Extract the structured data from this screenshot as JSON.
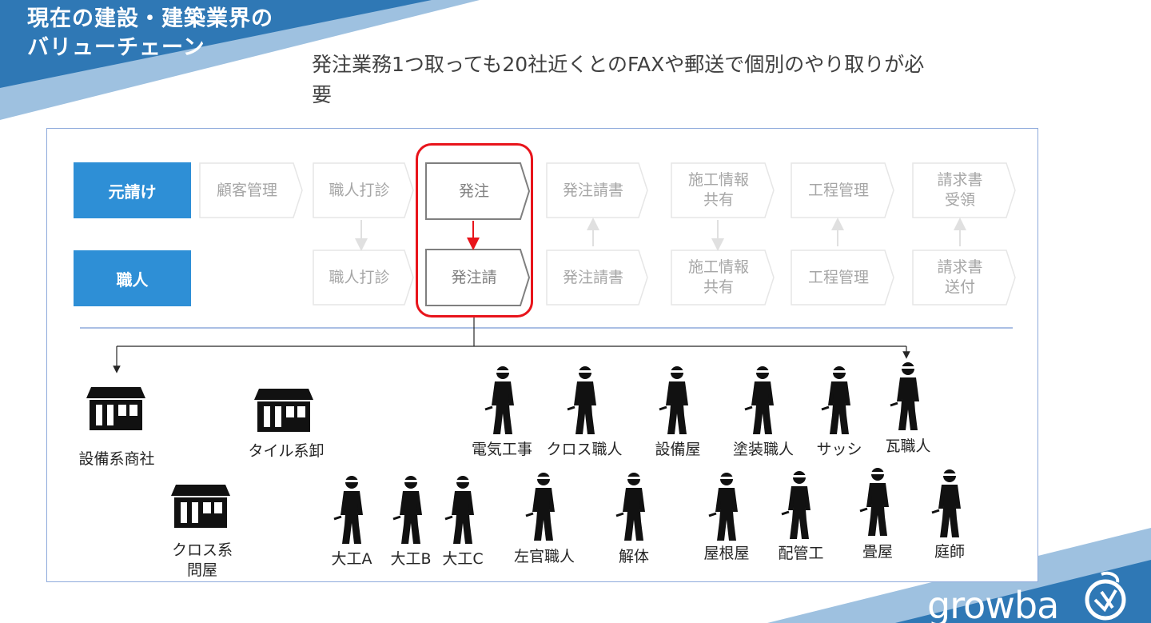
{
  "title": "現在の建設・建築業界の\nバリューチェーン",
  "subtitle": "発注業務1つ取っても20社近くとのFAXや郵送で個別のやり取りが必要",
  "roles": {
    "motouke": "元請け",
    "shokunin": "職人"
  },
  "process_top": [
    {
      "label": "顧客管理"
    },
    {
      "label": "職人打診"
    },
    {
      "label": "発注",
      "active": true
    },
    {
      "label": "発注請書"
    },
    {
      "label": "施工情報\n共有"
    },
    {
      "label": "工程管理"
    },
    {
      "label": "請求書\n受領"
    }
  ],
  "process_bottom": [
    {
      "label": "職人打診"
    },
    {
      "label": "発注請",
      "active": true
    },
    {
      "label": "発注請書"
    },
    {
      "label": "施工情報\n共有"
    },
    {
      "label": "工程管理"
    },
    {
      "label": "請求書\n送付"
    }
  ],
  "suppliers": [
    {
      "label": "設備系商社"
    },
    {
      "label": "タイル系卸"
    },
    {
      "label": "クロス系\n問屋"
    }
  ],
  "workers_row1": [
    "電気工事",
    "クロス職人",
    "設備屋",
    "塗装職人",
    "サッシ",
    "瓦職人"
  ],
  "workers_row2": [
    "大工A",
    "大工B",
    "大工C",
    "左官職人",
    "解体",
    "屋根屋",
    "配管工",
    "畳屋",
    "庭師"
  ],
  "logo": {
    "text": "growba"
  },
  "colors": {
    "role_bg": "#2e8fd6",
    "highlight": "#e8141b",
    "banner": "#2f78b5",
    "arrow_red": "#e8141b"
  },
  "icons": {
    "supplier": "shop-icon",
    "worker": "worker-icon",
    "logo": "logo-mark-icon"
  }
}
